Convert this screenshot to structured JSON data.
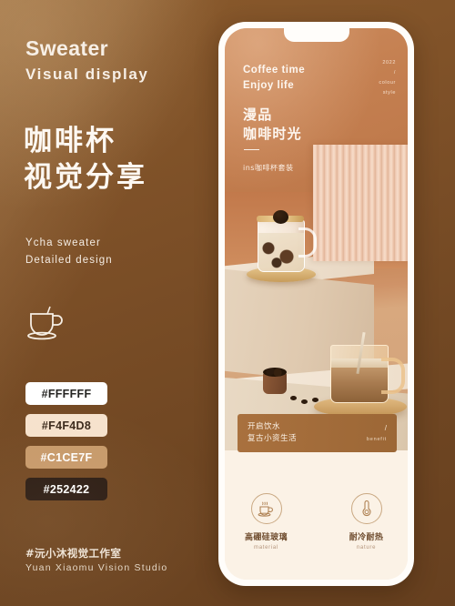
{
  "poster": {
    "background_color": "#7a4e26",
    "left": {
      "title_en_line1": "Sweater",
      "title_en_line2": "Visual  display",
      "title_cn_line1": "咖啡杯",
      "title_cn_line2": "视觉分享",
      "subtitle_line1": "Ycha  sweater",
      "subtitle_line2": "Detailed  design",
      "icon": "coffee-cup-icon",
      "swatches": [
        {
          "label": "#FFFFFF",
          "bg": "#FFFFFF",
          "fg": "#252422"
        },
        {
          "label": "#F4F4D8",
          "bg": "#F6E2CD",
          "fg": "#3b2a1c"
        },
        {
          "label": "#C1CE7F",
          "bg": "#C79A6B",
          "fg": "#FFFFFF"
        },
        {
          "label": "#252422",
          "bg": "#2B1C14",
          "fg": "#FFFFFF"
        }
      ],
      "studio_cn": "#沅小沐视觉工作室",
      "studio_en": "Yuan  Xiaomu  Vision  Studio"
    },
    "phone": {
      "hero": {
        "en_line1": "Coffee time",
        "en_line2": "Enjoy life",
        "cn_line1": "漫品",
        "cn_line2": "咖啡时光",
        "tag": "ins咖啡杯套装",
        "corner_year": "2022",
        "corner_slash": "/",
        "corner_line1": "colour",
        "corner_line2": "style"
      },
      "card": {
        "line1": "开启饮水",
        "line2": "复古小资生活",
        "slash": "/",
        "benefit": "benefit"
      },
      "features": [
        {
          "icon": "steaming-cup-icon",
          "cn": "高硼硅玻璃",
          "en": "material"
        },
        {
          "icon": "thermometer-icon",
          "cn": "耐冷耐热",
          "en": "nature"
        }
      ]
    }
  }
}
